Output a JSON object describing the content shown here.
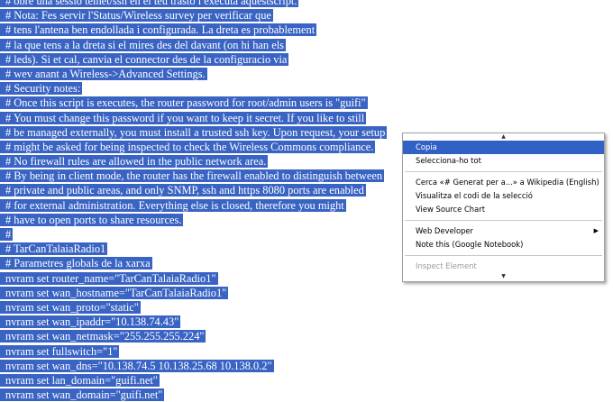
{
  "document": {
    "lines": [
      "# obre una sessio telnet/ssh en el teu trasto i executa aquestscript.",
      "# Nota: Fes servir l'Status/Wireless survey per verificar que",
      "# tens l'antena ben endollada i configurada. La dreta es probablement",
      "# la que tens a la dreta si el mires des del davant (on hi han els",
      "# leds). Si et cal, canvia el connector des de la configuracio via",
      "# wev anant a Wireless->Advanced Settings.",
      "# Security notes:",
      "# Once this script is executes, the router password for root/admin users is \"guifi\"",
      "# You must change this password if you want to keep it secret. If you like to still",
      "# be managed externally, you must install a trusted ssh key. Upon request, your setup",
      "# might be asked for being inspected to check the Wireless Commons compliance.",
      "# No firewall rules are allowed in the public network area.",
      "# By being in client mode, the router has the firewall enabled to distinguish between",
      "# private and public areas, and only SNMP, ssh and https 8080 ports are enabled",
      "# for external administration. Everything else is closed, therefore you might",
      "# have to open ports to share resources.",
      "#",
      "# TarCanTalaiaRadio1",
      "# Parametres globals de la xarxa",
      "nvram set router_name=\"TarCanTalaiaRadio1\"",
      "nvram set wan_hostname=\"TarCanTalaiaRadio1\"",
      "nvram set wan_proto=\"static\"",
      "nvram set wan_ipaddr=\"10.138.74.43\"",
      "nvram set wan_netmask=\"255.255.255.224\"",
      "nvram set fullswitch=\"1\"",
      "nvram set wan_dns=\"10.138.74.5 10.138.25.68 10.138.0.2\"",
      "nvram set lan_domain=\"guifi.net\"",
      "nvram set wan_domain=\"guifi.net\""
    ]
  },
  "context_menu": {
    "scroll_up_icon": "triangle-up-icon",
    "scroll_down_icon": "triangle-down-icon",
    "items": [
      {
        "label": "Copia",
        "active": true,
        "disabled": false
      },
      {
        "label": "Selecciona-ho tot",
        "active": false,
        "disabled": false
      },
      {
        "separator": true
      },
      {
        "label": "Cerca «# Generat per a...» a Wikipedia (English)",
        "active": false,
        "disabled": false
      },
      {
        "label": "Visualitza el codi de la selecció",
        "active": false,
        "disabled": false
      },
      {
        "label": "View Source Chart",
        "active": false,
        "disabled": false
      },
      {
        "separator": true
      },
      {
        "label": "Web Developer",
        "active": false,
        "disabled": false,
        "submenu": true
      },
      {
        "label": "Note this (Google Notebook)",
        "active": false,
        "disabled": false
      },
      {
        "separator": true
      },
      {
        "label": "Inspect Element",
        "active": false,
        "disabled": true
      }
    ],
    "colors": {
      "highlight": "#3161c5",
      "selection": "#3a64c4",
      "disabled_text": "#9a9a9a"
    }
  }
}
